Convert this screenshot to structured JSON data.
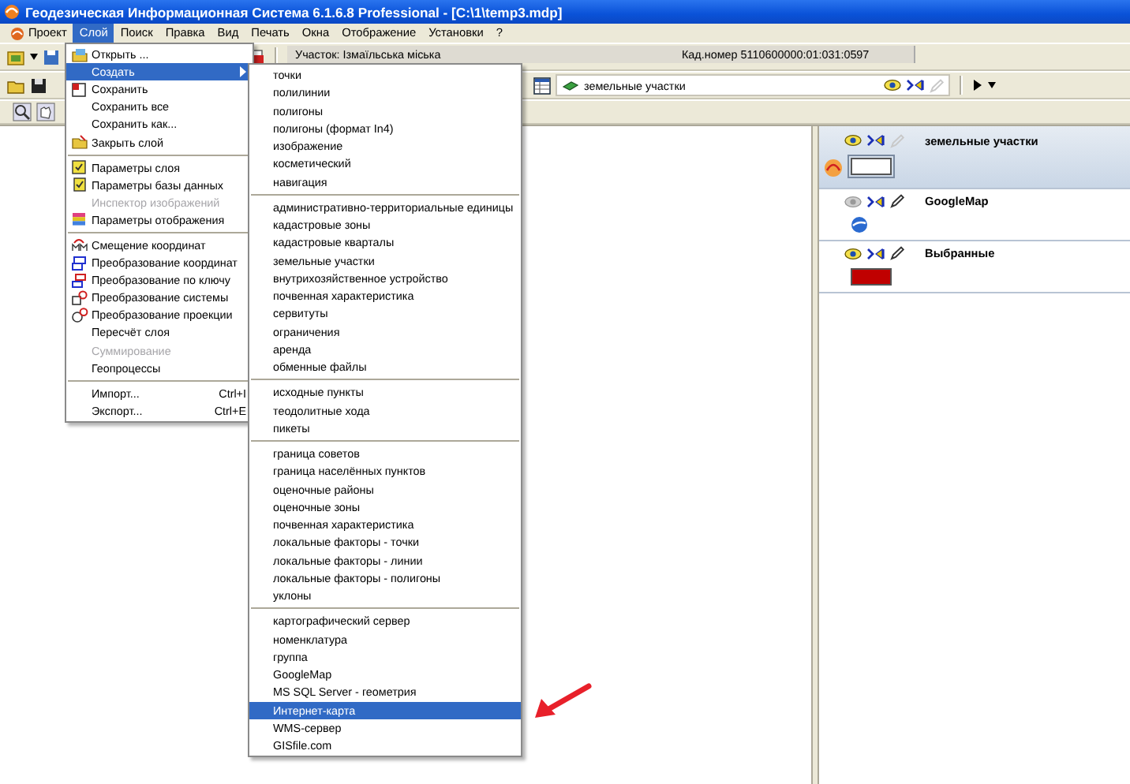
{
  "window": {
    "title": "Геодезическая Информационная Система 6.1.6.8 Professional - [C:\\1\\temp3.mdp]"
  },
  "menu_bar": [
    {
      "label": "Проект",
      "selected": false
    },
    {
      "label": "Слой",
      "selected": true
    },
    {
      "label": "Поиск",
      "selected": false
    },
    {
      "label": "Правка",
      "selected": false
    },
    {
      "label": "Вид",
      "selected": false
    },
    {
      "label": "Печать",
      "selected": false
    },
    {
      "label": "Окна",
      "selected": false
    },
    {
      "label": "Отображение",
      "selected": false
    },
    {
      "label": "Установки",
      "selected": false
    },
    {
      "label": "?",
      "selected": false
    }
  ],
  "toolbar": {
    "plot": "Участок: Ізмаїльська міська",
    "cadastral": "Кад.номер  5110600000:01:031:0597",
    "active_layer": "земельные участки"
  },
  "layer_menu": {
    "groups": [
      [
        {
          "label": "Открыть ...",
          "kind": "open",
          "selected": false,
          "disabled": false
        },
        {
          "label": "Создать",
          "kind": "plain",
          "selected": true,
          "disabled": false,
          "submenu": true
        },
        {
          "label": "Сохранить",
          "kind": "save",
          "selected": false,
          "disabled": false
        },
        {
          "label": "Сохранить все",
          "kind": "plain",
          "selected": false,
          "disabled": false
        },
        {
          "label": "Сохранить как...",
          "kind": "plain",
          "selected": false,
          "disabled": false
        },
        {
          "label": "Закрыть слой",
          "kind": "close",
          "selected": false,
          "disabled": false
        }
      ],
      [
        {
          "label": "Параметры слоя",
          "kind": "layer",
          "selected": false,
          "disabled": false
        },
        {
          "label": "Параметры базы данных",
          "kind": "database",
          "selected": false,
          "disabled": false
        },
        {
          "label": "Инспектор изображений",
          "kind": "plain",
          "selected": false,
          "disabled": true
        },
        {
          "label": "Параметры отображения",
          "kind": "display",
          "selected": false,
          "disabled": false
        }
      ],
      [
        {
          "label": "Смещение координат",
          "kind": "shift",
          "selected": false,
          "disabled": false
        },
        {
          "label": "Преобразование координат",
          "kind": "transform",
          "selected": false,
          "disabled": false
        },
        {
          "label": "Преобразование по ключу",
          "kind": "key",
          "selected": false,
          "disabled": false
        },
        {
          "label": "Преобразование системы",
          "kind": "system",
          "selected": false,
          "disabled": false
        },
        {
          "label": "Преобразование проекции",
          "kind": "projection",
          "selected": false,
          "disabled": false
        },
        {
          "label": "Пересчёт слоя",
          "kind": "plain",
          "selected": false,
          "disabled": false
        },
        {
          "label": "Суммирование",
          "kind": "plain",
          "selected": false,
          "disabled": true
        },
        {
          "label": "Геопроцессы",
          "kind": "plain",
          "selected": false,
          "disabled": false
        }
      ],
      [
        {
          "label": "Импорт...",
          "kind": "plain",
          "selected": false,
          "disabled": false,
          "shortcut": "Ctrl+I"
        },
        {
          "label": "Экспорт...",
          "kind": "plain",
          "selected": false,
          "disabled": false,
          "shortcut": "Ctrl+E"
        }
      ]
    ]
  },
  "create_submenu": {
    "groups": [
      [
        {
          "label": "точки",
          "selected": false
        },
        {
          "label": "полилинии",
          "selected": false
        },
        {
          "label": "полигоны",
          "selected": false
        },
        {
          "label": "полигоны (формат In4)",
          "selected": false
        },
        {
          "label": "изображение",
          "selected": false
        },
        {
          "label": "косметический",
          "selected": false
        },
        {
          "label": "навигация",
          "selected": false
        }
      ],
      [
        {
          "label": "административно-территориальные единицы",
          "selected": false
        },
        {
          "label": "кадастровые зоны",
          "selected": false
        },
        {
          "label": "кадастровые кварталы",
          "selected": false
        },
        {
          "label": "земельные участки",
          "selected": false
        },
        {
          "label": "внутрихозяйственное устройство",
          "selected": false
        },
        {
          "label": "почвенная характеристика",
          "selected": false
        },
        {
          "label": "сервитуты",
          "selected": false
        },
        {
          "label": "ограничения",
          "selected": false
        },
        {
          "label": "аренда",
          "selected": false
        },
        {
          "label": "обменные файлы",
          "selected": false
        }
      ],
      [
        {
          "label": "исходные пункты",
          "selected": false
        },
        {
          "label": "теодолитные хода",
          "selected": false
        },
        {
          "label": "пикеты",
          "selected": false
        }
      ],
      [
        {
          "label": "граница советов",
          "selected": false
        },
        {
          "label": "граница населённых пунктов",
          "selected": false
        },
        {
          "label": "оценочные районы",
          "selected": false
        },
        {
          "label": "оценочные зоны",
          "selected": false
        },
        {
          "label": "почвенная характеристика",
          "selected": false
        },
        {
          "label": "локальные факторы - точки",
          "selected": false
        },
        {
          "label": "локальные факторы - линии",
          "selected": false
        },
        {
          "label": "локальные факторы - полигоны",
          "selected": false
        },
        {
          "label": "уклоны",
          "selected": false
        }
      ],
      [
        {
          "label": "картографический сервер",
          "selected": false
        },
        {
          "label": "номенклатура",
          "selected": false
        },
        {
          "label": "группа",
          "selected": false
        },
        {
          "label": "GoogleMap",
          "selected": false
        },
        {
          "label": "MS SQL Server - геометрия",
          "selected": false
        },
        {
          "label": "Интернет-карта",
          "selected": true
        },
        {
          "label": "WMS-сервер",
          "selected": false
        },
        {
          "label": "GISfile.com",
          "selected": false
        }
      ]
    ]
  },
  "layers": [
    {
      "name": "земельные участки",
      "selected": true,
      "visible": true,
      "editable": false,
      "logo": true,
      "kind": "box",
      "color": "#ffffff"
    },
    {
      "name": "GoogleMap",
      "selected": false,
      "visible": false,
      "editable": true,
      "logo": false,
      "kind": "globe"
    },
    {
      "name": "Выбранные",
      "selected": false,
      "visible": true,
      "editable": true,
      "logo": false,
      "kind": "box",
      "color": "#c00000"
    }
  ]
}
